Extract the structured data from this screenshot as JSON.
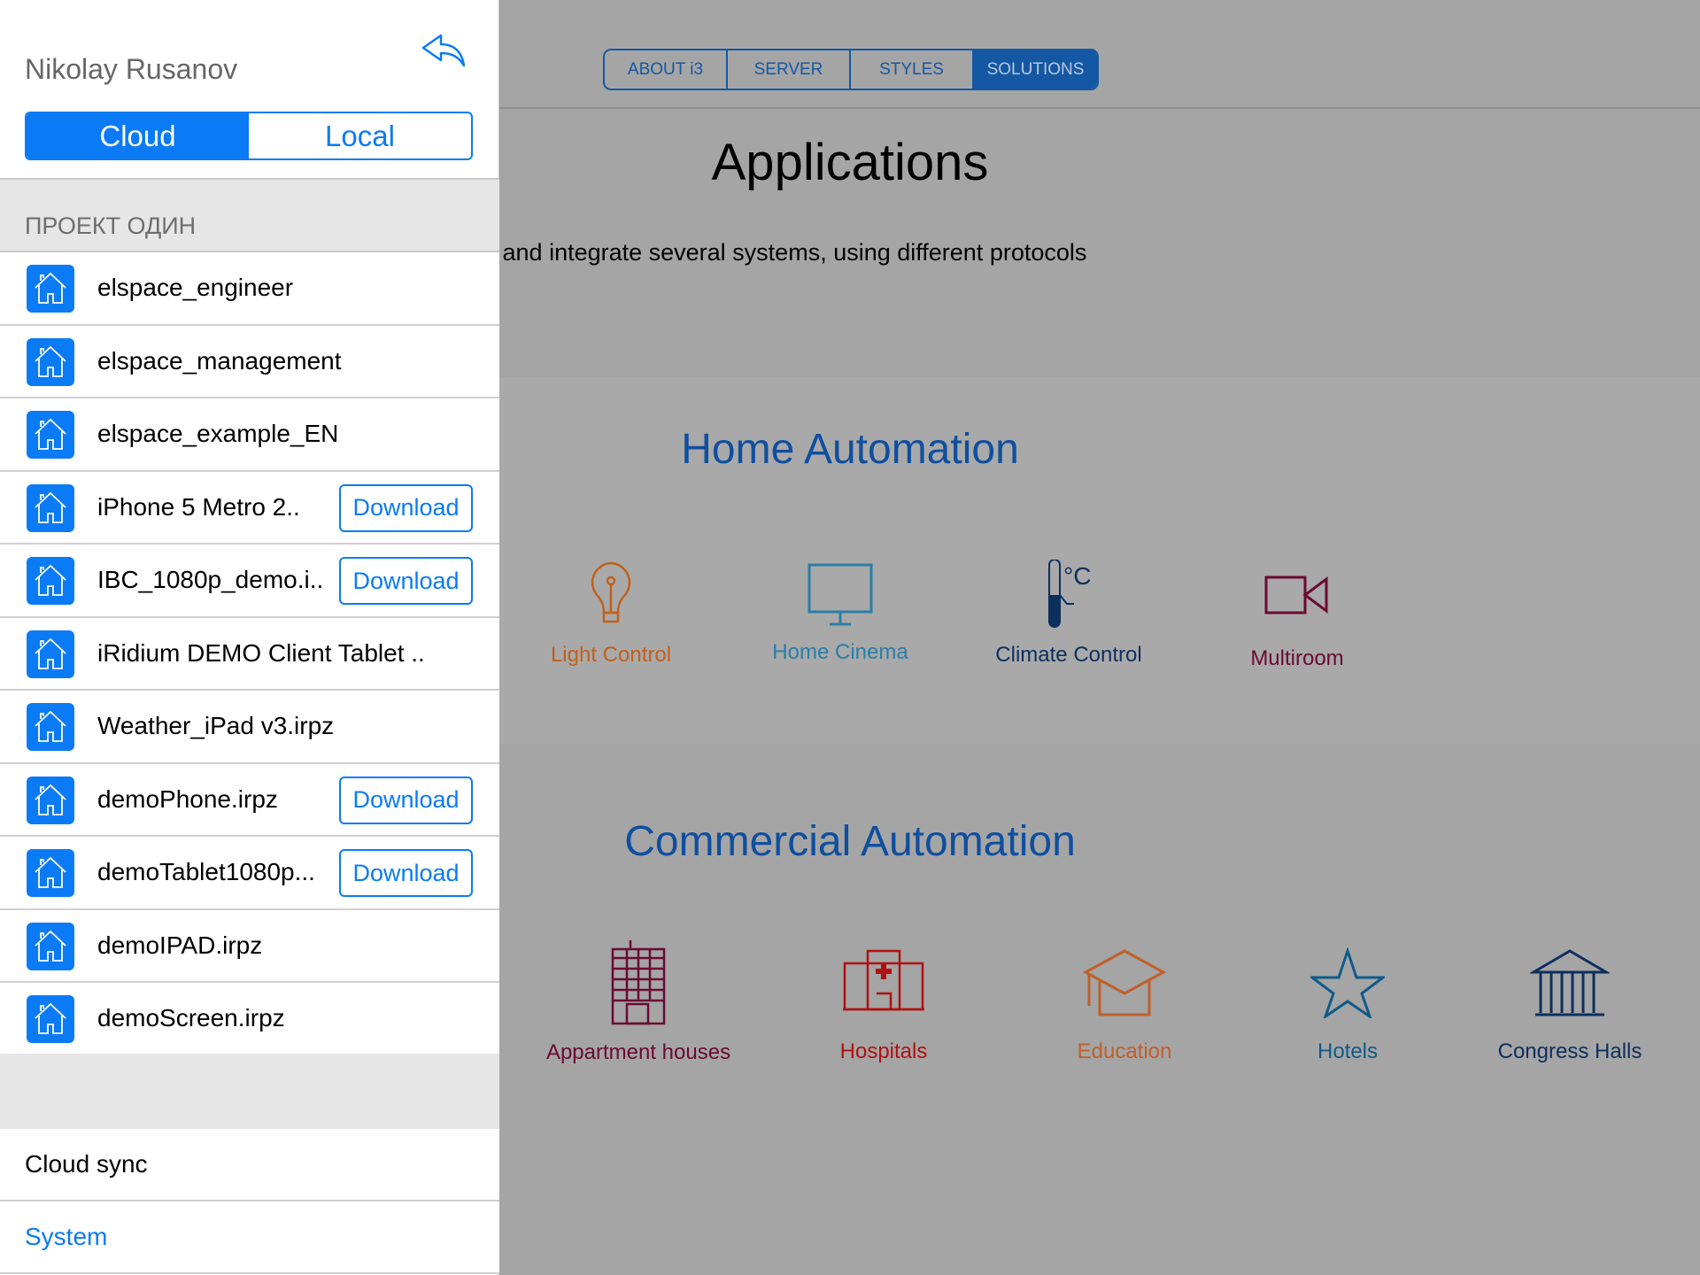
{
  "tabs": [
    "ABOUT i3",
    "SERVER",
    "STYLES",
    "SOLUTIONS"
  ],
  "active_tab": "SOLUTIONS",
  "main": {
    "title": "Applications",
    "subtitle": "g and integrate several systems, using different protocols",
    "home": {
      "title": "Home Automation",
      "items": [
        {
          "label": "Light Control",
          "icon": "light-bulb-icon",
          "color": "#c0601c"
        },
        {
          "label": "Home Cinema",
          "icon": "monitor-icon",
          "color": "#2a7ea8"
        },
        {
          "label": "Climate Control",
          "icon": "thermometer-icon",
          "color": "#0d2f5e"
        },
        {
          "label": "Multiroom",
          "icon": "video-camera-icon",
          "color": "#6a0a30"
        }
      ]
    },
    "commercial": {
      "title": "Commercial Automation",
      "items": [
        {
          "label": "Appartment houses",
          "icon": "apartment-building-icon",
          "color": "#6a0a30"
        },
        {
          "label": "Hospitals",
          "icon": "hospital-icon",
          "color": "#b01010"
        },
        {
          "label": "Education",
          "icon": "graduation-cap-icon",
          "color": "#c0602a"
        },
        {
          "label": "Hotels",
          "icon": "star-icon",
          "color": "#0e5a8a"
        },
        {
          "label": "Congress Halls",
          "icon": "columns-building-icon",
          "color": "#0d2f5e"
        }
      ]
    }
  },
  "sidebar": {
    "user": "Nikolay Rusanov",
    "segments": [
      "Cloud",
      "Local"
    ],
    "active_segment": "Cloud",
    "section": "ПРОЕКТ ОДИН",
    "projects": [
      {
        "name": "elspace_engineer",
        "download": null
      },
      {
        "name": "elspace_management",
        "download": null
      },
      {
        "name": "elspace_example_EN",
        "download": null
      },
      {
        "name": "iPhone 5 Metro 2..",
        "download": "Download"
      },
      {
        "name": "IBC_1080p_demo.i..",
        "download": "Download"
      },
      {
        "name": "iRidium DEMO Client Tablet ..",
        "download": null
      },
      {
        "name": "Weather_iPad v3.irpz",
        "download": null
      },
      {
        "name": "demoPhone.irpz",
        "download": "Download"
      },
      {
        "name": "demoTablet1080p...",
        "download": "Download"
      },
      {
        "name": "demoIPAD.irpz",
        "download": null
      },
      {
        "name": "demoScreen.irpz",
        "download": null
      }
    ],
    "cloud_sync": "Cloud sync",
    "system": "System"
  },
  "accent": "#0a7bf5"
}
